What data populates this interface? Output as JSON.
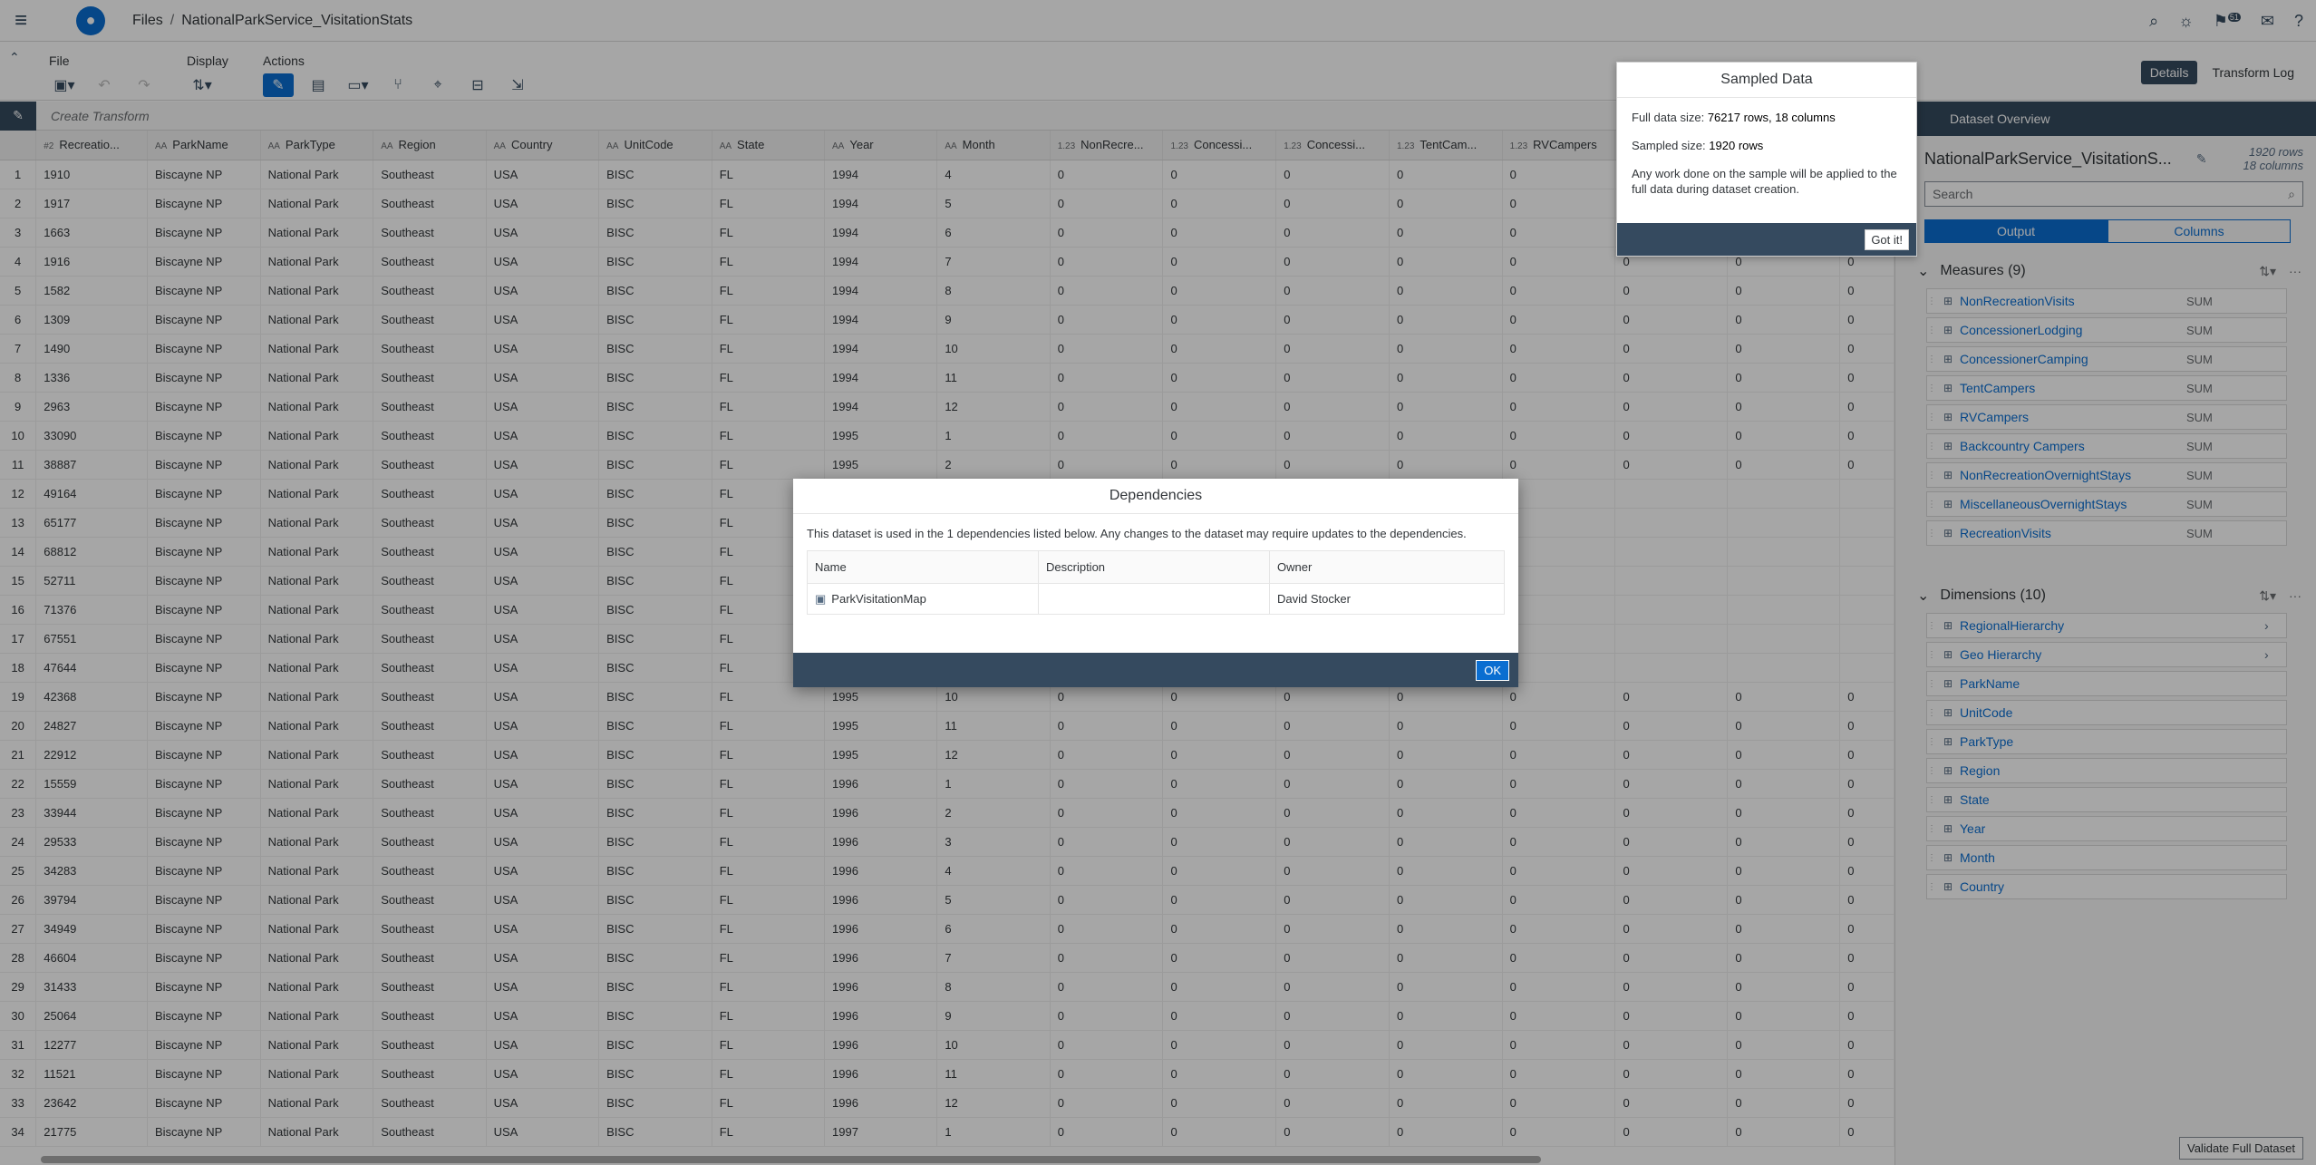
{
  "shell": {
    "breadcrumb_root": "Files",
    "breadcrumb_file": "NationalParkService_VisitationStats",
    "notification_count": "51"
  },
  "toolbar": {
    "file_label": "File",
    "display_label": "Display",
    "actions_label": "Actions",
    "details_tab": "Details",
    "transform_log_tab": "Transform Log"
  },
  "transform": {
    "placeholder": "Create Transform"
  },
  "grid": {
    "columns": [
      {
        "type": "#2",
        "name": "Recreatio..."
      },
      {
        "type": "AA",
        "name": "ParkName"
      },
      {
        "type": "AA",
        "name": "ParkType"
      },
      {
        "type": "AA",
        "name": "Region"
      },
      {
        "type": "AA",
        "name": "Country"
      },
      {
        "type": "AA",
        "name": "UnitCode"
      },
      {
        "type": "AA",
        "name": "State"
      },
      {
        "type": "AA",
        "name": "Year"
      },
      {
        "type": "AA",
        "name": "Month"
      },
      {
        "type": "1.23",
        "name": "NonRecre..."
      },
      {
        "type": "1.23",
        "name": "Concessi..."
      },
      {
        "type": "1.23",
        "name": "Concessi..."
      },
      {
        "type": "1.23",
        "name": "TentCam..."
      },
      {
        "type": "1.23",
        "name": "RVCampers"
      },
      {
        "type": "",
        "name": ""
      },
      {
        "type": "",
        "name": ""
      },
      {
        "type": "",
        "name": ""
      }
    ],
    "rows": [
      [
        "1",
        "1910",
        "1994",
        "4"
      ],
      [
        "2",
        "1917",
        "1994",
        "5"
      ],
      [
        "3",
        "1663",
        "1994",
        "6"
      ],
      [
        "4",
        "1916",
        "1994",
        "7"
      ],
      [
        "5",
        "1582",
        "1994",
        "8"
      ],
      [
        "6",
        "1309",
        "1994",
        "9"
      ],
      [
        "7",
        "1490",
        "1994",
        "10"
      ],
      [
        "8",
        "1336",
        "1994",
        "11"
      ],
      [
        "9",
        "2963",
        "1994",
        "12"
      ],
      [
        "10",
        "33090",
        "1995",
        "1"
      ],
      [
        "11",
        "38887",
        "1995",
        "2"
      ],
      [
        "12",
        "49164",
        "",
        ""
      ],
      [
        "13",
        "65177",
        "",
        ""
      ],
      [
        "14",
        "68812",
        "",
        ""
      ],
      [
        "15",
        "52711",
        "",
        ""
      ],
      [
        "16",
        "71376",
        "",
        ""
      ],
      [
        "17",
        "67551",
        "",
        ""
      ],
      [
        "18",
        "47644",
        "",
        ""
      ],
      [
        "19",
        "42368",
        "1995",
        "10"
      ],
      [
        "20",
        "24827",
        "1995",
        "11"
      ],
      [
        "21",
        "22912",
        "1995",
        "12"
      ],
      [
        "22",
        "15559",
        "1996",
        "1"
      ],
      [
        "23",
        "33944",
        "1996",
        "2"
      ],
      [
        "24",
        "29533",
        "1996",
        "3"
      ],
      [
        "25",
        "34283",
        "1996",
        "4"
      ],
      [
        "26",
        "39794",
        "1996",
        "5"
      ],
      [
        "27",
        "34949",
        "1996",
        "6"
      ],
      [
        "28",
        "46604",
        "1996",
        "7"
      ],
      [
        "29",
        "31433",
        "1996",
        "8"
      ],
      [
        "30",
        "25064",
        "1996",
        "9"
      ],
      [
        "31",
        "12277",
        "1996",
        "10"
      ],
      [
        "32",
        "11521",
        "1996",
        "11"
      ],
      [
        "33",
        "23642",
        "1996",
        "12"
      ],
      [
        "34",
        "21775",
        "1997",
        "1"
      ]
    ],
    "const": {
      "park": "Biscayne NP",
      "type": "National Park",
      "region": "Southeast",
      "country": "USA",
      "unit": "BISC",
      "state": "FL",
      "zero": "0"
    }
  },
  "side": {
    "header": "Dataset Overview",
    "dataset_name": "NationalParkService_VisitationS...",
    "rows": "1920 rows",
    "cols": "18 columns",
    "search_placeholder": "Search",
    "tab_output": "Output",
    "tab_columns": "Columns",
    "measures_title": "Measures (9)",
    "measures": [
      "NonRecreationVisits",
      "ConcessionerLodging",
      "ConcessionerCamping",
      "TentCampers",
      "RVCampers",
      "Backcountry Campers",
      "NonRecreationOvernightStays",
      "MiscellaneousOvernightStays",
      "RecreationVisits"
    ],
    "agg": "SUM",
    "dimensions_title": "Dimensions (10)",
    "hierarchies": [
      "RegionalHierarchy",
      "Geo Hierarchy"
    ],
    "dimensions": [
      "ParkName",
      "UnitCode",
      "ParkType",
      "Region",
      "State",
      "Year",
      "Month",
      "Country"
    ],
    "validate": "Validate Full Dataset"
  },
  "popover": {
    "title": "Sampled Data",
    "full_label": "Full data size:",
    "full_value": "76217 rows, 18 columns",
    "sample_label": "Sampled size:",
    "sample_value": "1920 rows",
    "note": "Any work done on the sample will be applied to the full data during dataset creation.",
    "button": "Got it!"
  },
  "dialog": {
    "title": "Dependencies",
    "message": "This dataset is used in the 1 dependencies listed below. Any changes to the dataset may require updates to the dependencies.",
    "col_name": "Name",
    "col_desc": "Description",
    "col_owner": "Owner",
    "dep_name": "ParkVisitationMap",
    "dep_desc": "",
    "dep_owner": "David Stocker",
    "ok": "OK"
  }
}
